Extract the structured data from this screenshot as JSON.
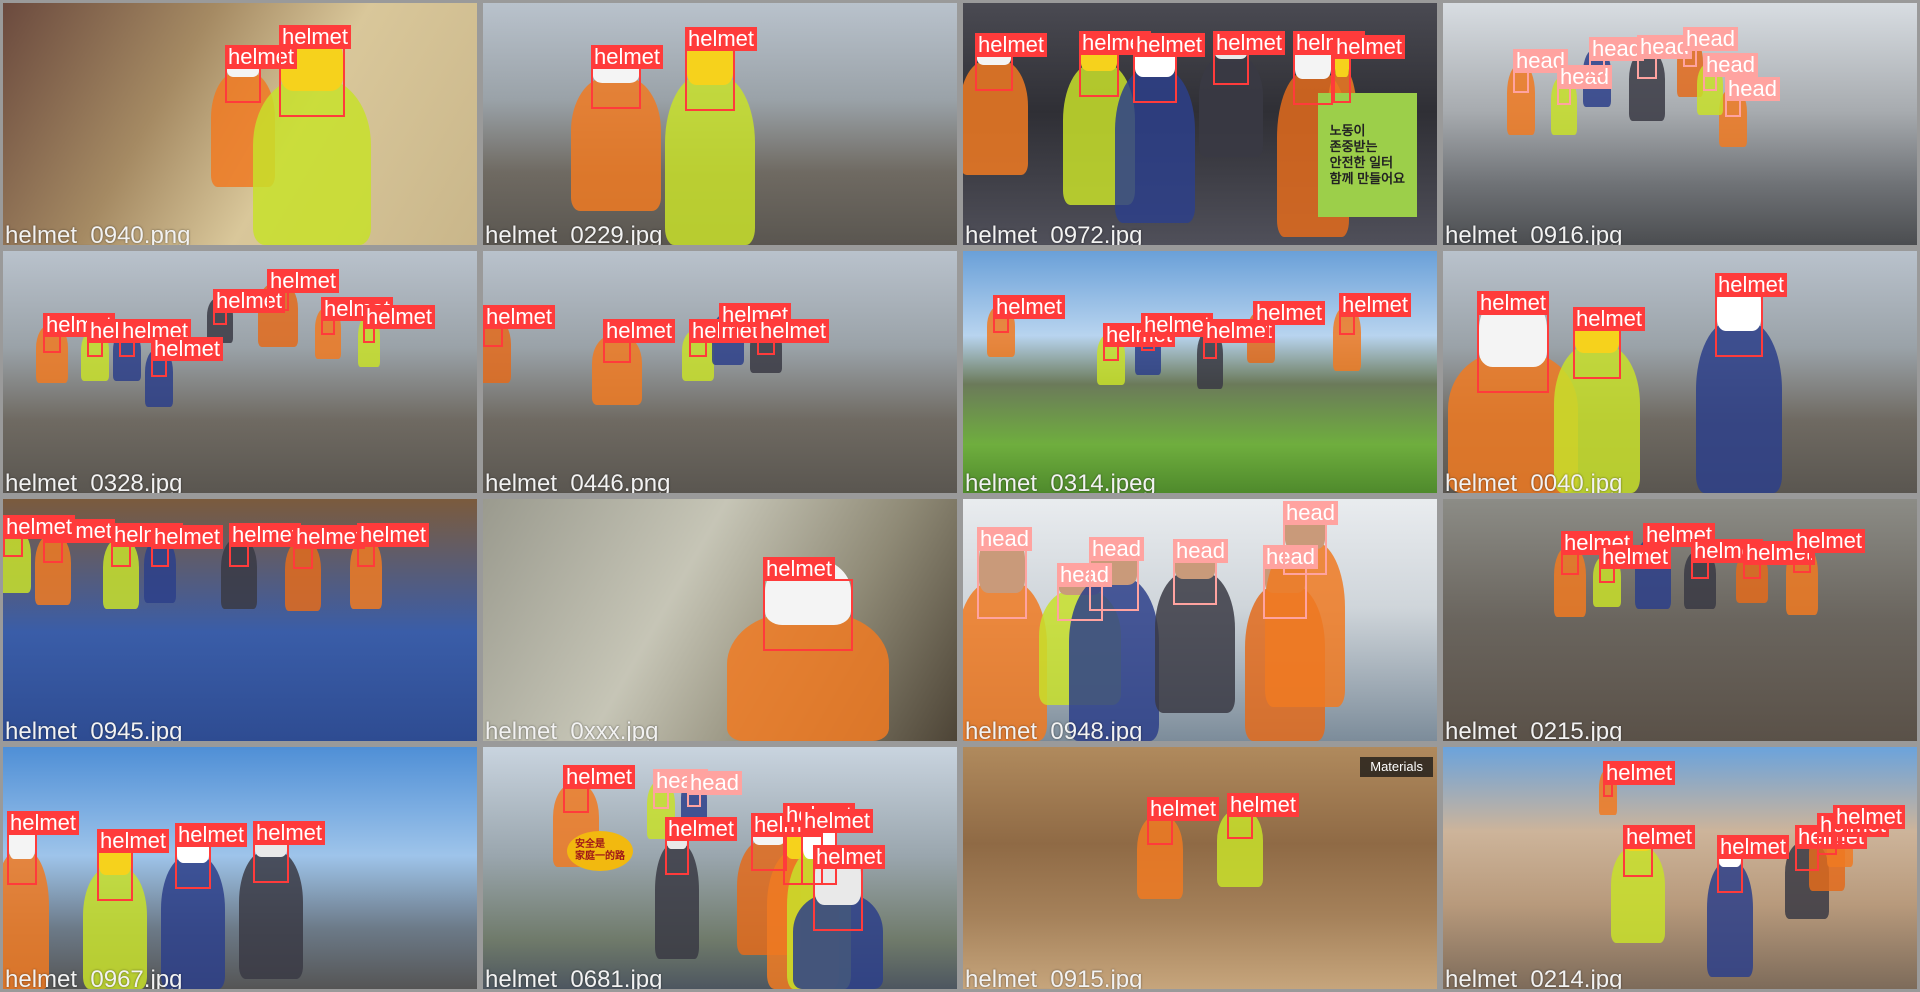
{
  "class_colors": {
    "helmet": "#ff3b3b",
    "head": "#ffa3a0"
  },
  "tiles": [
    {
      "caption": "helmet_0940.png",
      "scene": "indoor",
      "labels": [
        "helmet",
        "helmet"
      ]
    },
    {
      "caption": "helmet_0229.jpg",
      "scene": "site",
      "labels": [
        "helmet",
        "helmet"
      ]
    },
    {
      "caption": "helmet_0972.jpg",
      "scene": "protest",
      "labels": [
        "helmet",
        "helmet",
        "helmet",
        "helmet",
        "helmet",
        "helmet"
      ],
      "overlay_text": [
        "노동이",
        "존중받는",
        "안전한 일터",
        "함께 만들어요"
      ]
    },
    {
      "caption": "helmet_0916.jpg",
      "scene": "street",
      "labels": [
        "head",
        "head",
        "head",
        "head",
        "head",
        "head",
        "head"
      ]
    },
    {
      "caption": "helmet_0328.jpg",
      "scene": "site",
      "labels": [
        "helmet",
        "helmet",
        "helmet",
        "helmet",
        "helmet",
        "helmet",
        "helmet",
        "helmet"
      ]
    },
    {
      "caption": "helmet_0446.png",
      "scene": "site",
      "labels": [
        "helmet",
        "helmet",
        "helmet",
        "helmet",
        "helmet"
      ]
    },
    {
      "caption": "helmet_0314.jpeg",
      "scene": "field",
      "labels": [
        "helmet",
        "helmet",
        "helmet",
        "helmet",
        "helmet",
        "helmet"
      ]
    },
    {
      "caption": "helmet_0040.jpg",
      "scene": "site",
      "labels": [
        "helmet",
        "helmet",
        "helmet"
      ]
    },
    {
      "caption": "helmet_0945.jpg",
      "scene": "warehouse",
      "labels": [
        "helmet",
        "helmet",
        "helmet",
        "helmet",
        "helmet",
        "helmet",
        "helmet"
      ]
    },
    {
      "caption": "helmet_0xxx.jpg",
      "scene": "wall",
      "labels": [
        "helmet"
      ]
    },
    {
      "caption": "helmet_0948.jpg",
      "scene": "office",
      "labels": [
        "head",
        "head",
        "head",
        "head",
        "head",
        "head"
      ]
    },
    {
      "caption": "helmet_0215.jpg",
      "scene": "factory",
      "labels": [
        "helmet",
        "helmet",
        "helmet",
        "helmet",
        "helmet",
        "helmet",
        "helmet"
      ]
    },
    {
      "caption": "helmet_0967.jpg",
      "scene": "city",
      "labels": [
        "helmet",
        "helmet",
        "helmet",
        "helmet"
      ]
    },
    {
      "caption": "helmet_0681.jpg",
      "scene": "booth",
      "labels": [
        "helmet",
        "head",
        "head",
        "helmet",
        "helmet",
        "helmet",
        "helmet",
        "helmet"
      ],
      "overlay_text": [
        "安全是",
        "家庭一的路"
      ]
    },
    {
      "caption": "helmet_0915.jpg",
      "scene": "quarry",
      "labels": [
        "helmet",
        "helmet"
      ],
      "overlay_text": [
        "Materials"
      ]
    },
    {
      "caption": "helmet_0214.jpg",
      "scene": "rocks",
      "labels": [
        "helmet",
        "helmet",
        "helmet",
        "helmet",
        "helmet",
        "helmet"
      ]
    }
  ]
}
